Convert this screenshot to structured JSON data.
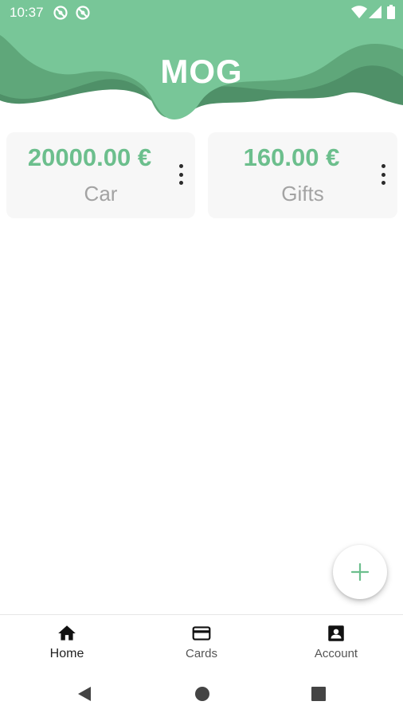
{
  "status_bar": {
    "time": "10:37",
    "icons": [
      "notification-off-icon",
      "notification-off-icon",
      "wifi-icon",
      "signal-icon",
      "battery-icon"
    ]
  },
  "header": {
    "title": "MOG",
    "colors": {
      "light": "#78c698",
      "mid": "#5fa77a",
      "dark": "#4f9068"
    }
  },
  "cards": [
    {
      "amount": "20000.00 €",
      "label": "Car",
      "menu_icon": "more-vert-icon"
    },
    {
      "amount": "160.00 €",
      "label": "Gifts",
      "menu_icon": "more-vert-icon"
    }
  ],
  "fab": {
    "icon": "plus-icon",
    "color": "#6cbf8d"
  },
  "bottom_nav": {
    "items": [
      {
        "label": "Home",
        "icon": "home-icon",
        "active": true
      },
      {
        "label": "Cards",
        "icon": "credit-card-icon",
        "active": false
      },
      {
        "label": "Account",
        "icon": "account-box-icon",
        "active": false
      }
    ]
  },
  "system_nav": {
    "icons": [
      "back-icon",
      "home-circle-icon",
      "recents-icon"
    ]
  },
  "accent": "#6cbf8d"
}
